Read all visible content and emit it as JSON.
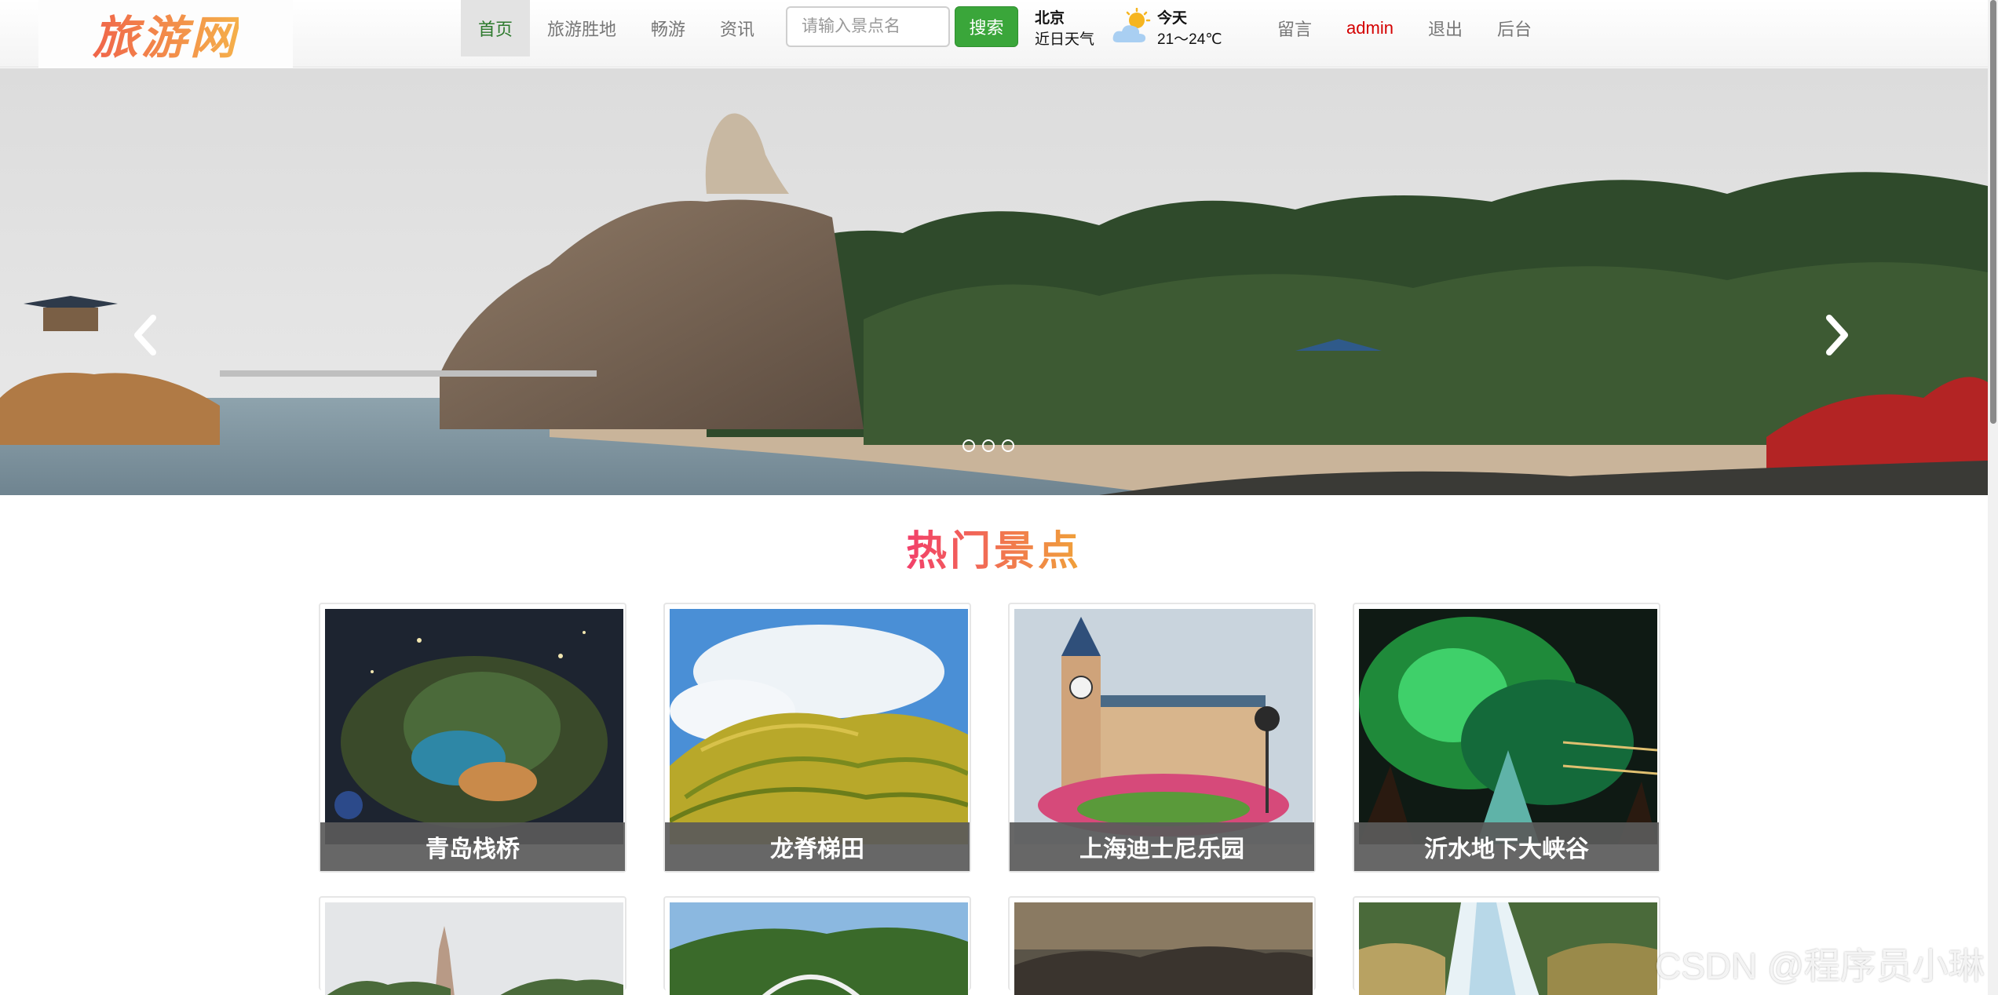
{
  "logo": {
    "text": "旅游网"
  },
  "nav": {
    "items": [
      {
        "label": "首页",
        "active": true
      },
      {
        "label": "旅游胜地",
        "active": false
      },
      {
        "label": "畅游",
        "active": false
      },
      {
        "label": "资讯",
        "active": false
      }
    ]
  },
  "search": {
    "placeholder": "请输入景点名",
    "value": "",
    "button_label": "搜索"
  },
  "weather": {
    "city": "北京",
    "subtitle": "近日天气",
    "day": "今天",
    "temp": "21～24℃",
    "icon": "partly-cloudy-icon"
  },
  "user_links": [
    {
      "label": "留言"
    },
    {
      "label": "admin"
    },
    {
      "label": "退出"
    },
    {
      "label": "后台"
    }
  ],
  "carousel": {
    "slide_count": 3,
    "active_slide": 0,
    "prev_icon": "chevron-left-icon",
    "next_icon": "chevron-right-icon"
  },
  "hot_section": {
    "title": "热门景点"
  },
  "attractions": [
    {
      "name": "青岛栈桥"
    },
    {
      "name": "龙脊梯田"
    },
    {
      "name": "上海迪士尼乐园"
    },
    {
      "name": "沂水地下大峡谷"
    },
    {
      "name": ""
    },
    {
      "name": ""
    },
    {
      "name": ""
    },
    {
      "name": ""
    }
  ],
  "watermark": "CSDN @程序员小琳",
  "colors": {
    "accent_green": "#3aa63a",
    "admin_red": "#d40000",
    "title_gradient_start": "#f23f6a",
    "title_gradient_end": "#f0a23a"
  }
}
